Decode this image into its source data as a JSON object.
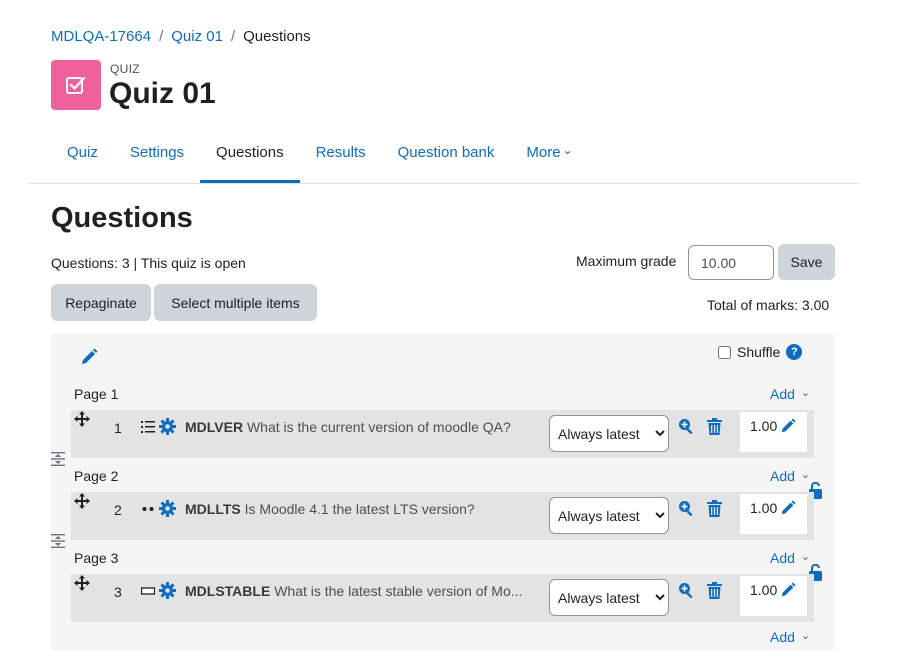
{
  "breadcrumb": {
    "course": "MDLQA-17664",
    "quiz": "Quiz 01",
    "current": "Questions",
    "separator": "/"
  },
  "header": {
    "kind": "QUIZ",
    "title": "Quiz 01"
  },
  "tabs": [
    {
      "label": "Quiz"
    },
    {
      "label": "Settings"
    },
    {
      "label": "Questions"
    },
    {
      "label": "Results"
    },
    {
      "label": "Question bank"
    },
    {
      "label": "More"
    }
  ],
  "main": {
    "heading": "Questions",
    "info": "Questions: 3 | This quiz is open",
    "max_grade_label": "Maximum grade",
    "max_grade_value": "10.00",
    "save_label": "Save",
    "repaginate_label": "Repaginate",
    "select_multiple_label": "Select multiple items",
    "total_marks": "Total of marks: 3.00",
    "shuffle_label": "Shuffle",
    "help_glyph": "?"
  },
  "pages": [
    {
      "label": "Page 1",
      "add_label": "Add"
    },
    {
      "label": "Page 2",
      "add_label": "Add"
    },
    {
      "label": "Page 3",
      "add_label": "Add"
    }
  ],
  "final_add_label": "Add",
  "slots": [
    {
      "number": "1",
      "qtype_icon": "multichoice-icon",
      "name": "MDLVER",
      "text": "What is the current version of moodle QA?",
      "version": "Always latest",
      "mark": "1.00"
    },
    {
      "number": "2",
      "qtype_icon": "truefalse-icon",
      "name": "MDLLTS",
      "text": "Is Moodle 4.1 the latest LTS version?",
      "version": "Always latest",
      "mark": "1.00"
    },
    {
      "number": "3",
      "qtype_icon": "shortanswer-icon",
      "name": "MDLSTABLE",
      "text": "What is the latest stable version of Mo...",
      "version": "Always latest",
      "mark": "1.00"
    }
  ],
  "colors": {
    "accent": "#0f6cbf",
    "quiz_icon_bg": "#f0609c",
    "panel_bg": "#f5f5f5",
    "slot_bg": "#e3e3e3",
    "button_bg": "#ced4da"
  }
}
